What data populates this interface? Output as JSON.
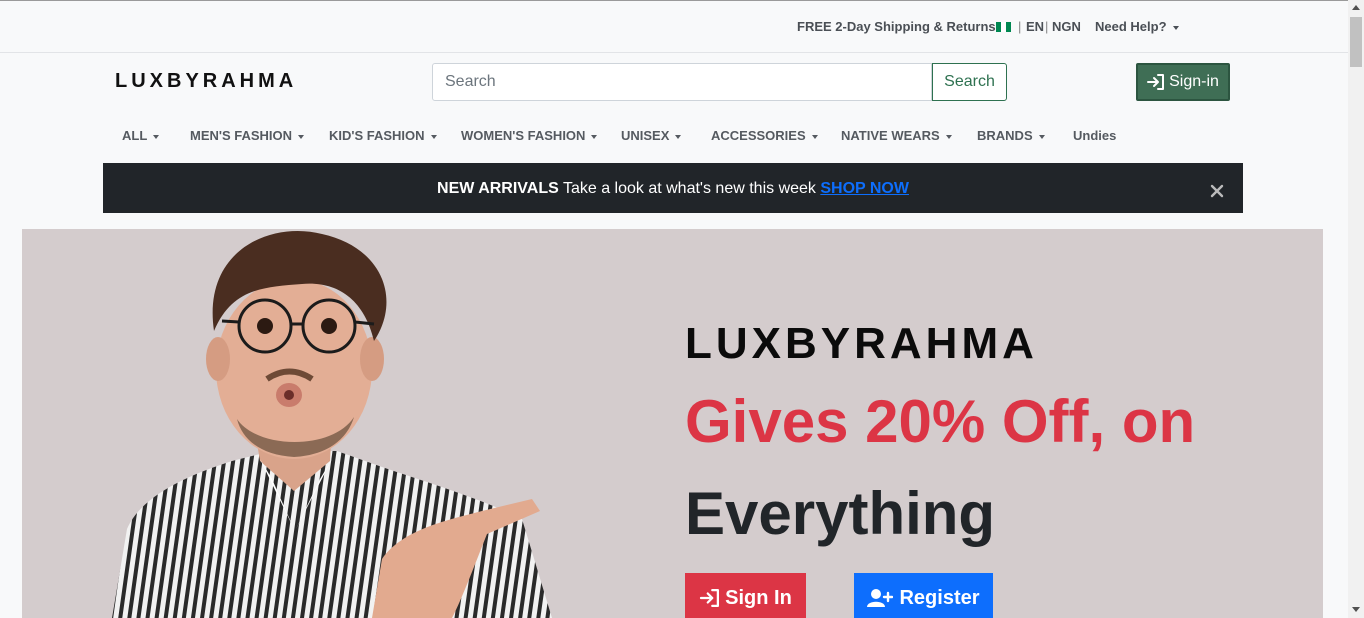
{
  "topbar": {
    "shipping": "FREE 2-Day Shipping & Returns",
    "language": "EN",
    "separator": "|",
    "currency": "NGN",
    "help": "Need Help?",
    "flag_colors": [
      "#008751",
      "#ffffff",
      "#008751"
    ]
  },
  "header": {
    "brand": "LUXBYRAHMA",
    "search_placeholder": "Search",
    "search_button": "Search",
    "signin_button": "Sign-in"
  },
  "nav": {
    "items": [
      {
        "label": "ALL",
        "dropdown": true
      },
      {
        "label": "MEN'S FASHION",
        "dropdown": true
      },
      {
        "label": "KID'S FASHION",
        "dropdown": true
      },
      {
        "label": "WOMEN'S FASHION",
        "dropdown": true
      },
      {
        "label": "UNISEX",
        "dropdown": true
      },
      {
        "label": "ACCESSORIES",
        "dropdown": true
      },
      {
        "label": "NATIVE WEARS",
        "dropdown": true
      },
      {
        "label": "BRANDS",
        "dropdown": true
      },
      {
        "label": "Undies",
        "dropdown": false
      }
    ]
  },
  "banner": {
    "strong": "NEW ARRIVALS",
    "text": " Take a look at what's new this week ",
    "link": "SHOP NOW"
  },
  "hero": {
    "title": "LUXBYRAHMA",
    "offer": "Gives 20% Off, on",
    "everything": "Everything",
    "signin_button": "Sign In",
    "register_button": "Register"
  },
  "colors": {
    "accent_green": "#3f6e55",
    "offer_red": "#dc3545",
    "register_blue": "#0d6efd",
    "banner_dark": "#212529",
    "hero_bg": "#d4cccd"
  }
}
